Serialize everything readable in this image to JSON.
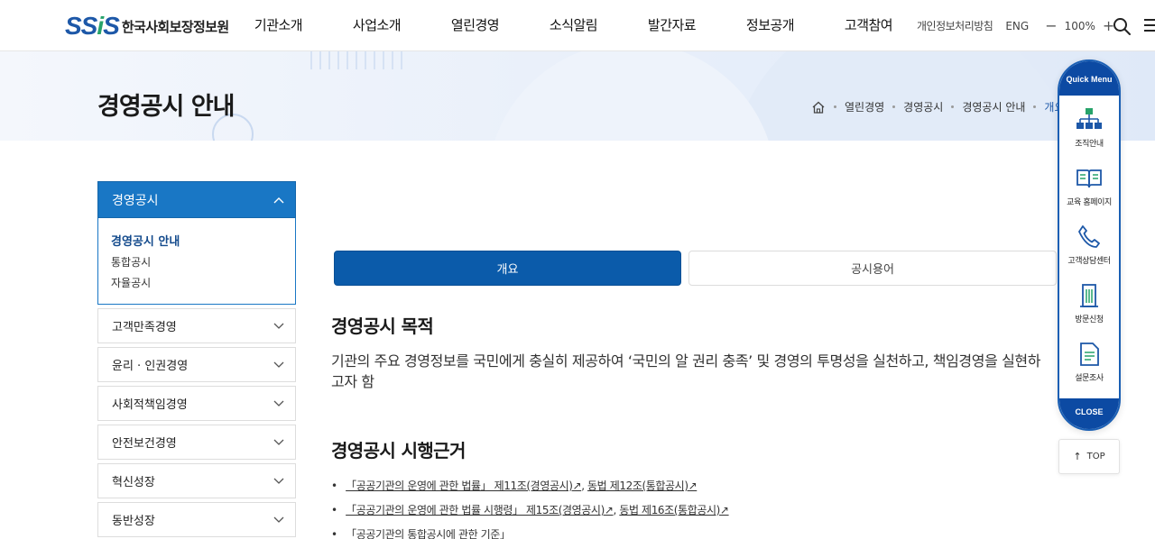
{
  "header": {
    "logo_mark": "SSiS",
    "logo_name": "한국사회보장정보원",
    "menu": [
      "기관소개",
      "사업소개",
      "열린경영",
      "소식알림",
      "발간자료",
      "정보공개",
      "고객참여"
    ],
    "privacy": "개인정보처리방침",
    "lang": "ENG",
    "zoom_minus": "−",
    "zoom_level": "100%",
    "zoom_plus": "+"
  },
  "visual": {
    "title": "경영공시 안내",
    "breadcrumb": [
      "열린경영",
      "경영공시",
      "경영공시 안내",
      "개요"
    ]
  },
  "lnb": {
    "head": "경영공시",
    "sub": [
      "경영공시 안내",
      "통합공시",
      "자율공시"
    ],
    "items": [
      "고객만족경영",
      "윤리 · 인권경영",
      "사회적책임경영",
      "안전보건경영",
      "혁신성장",
      "동반성장"
    ]
  },
  "tabs": [
    "개요",
    "공시용어"
  ],
  "content": {
    "purpose_title": "경영공시 목적",
    "purpose_body": "기관의 주요 경영정보를 국민에게 충실히 제공하여 ‘국민의 알 권리 충족’ 및 경영의 투명성을 실천하고, 책임경영을 실현하고자 함",
    "basis_title": "경영공시 시행근거",
    "laws": [
      {
        "a": "「공공기관의 운영에 관한 법률」 제11조(경영공시)↗",
        "b": "동법 제12조(통합공시)↗"
      },
      {
        "a": "「공공기관의 운영에 관한 법률 시행령」 제15조(경영공시)↗",
        "b": "동법 제16조(통합공시)↗"
      },
      {
        "a": "「공공기관의 통합공시에 관한 기준」",
        "b": ""
      }
    ]
  },
  "quick": {
    "head": "Quick Menu",
    "items": [
      "조직안내",
      "교육 홈페이지",
      "고객상담센터",
      "방문신청",
      "설문조사"
    ],
    "close": "CLOSE",
    "top": "TOP"
  }
}
